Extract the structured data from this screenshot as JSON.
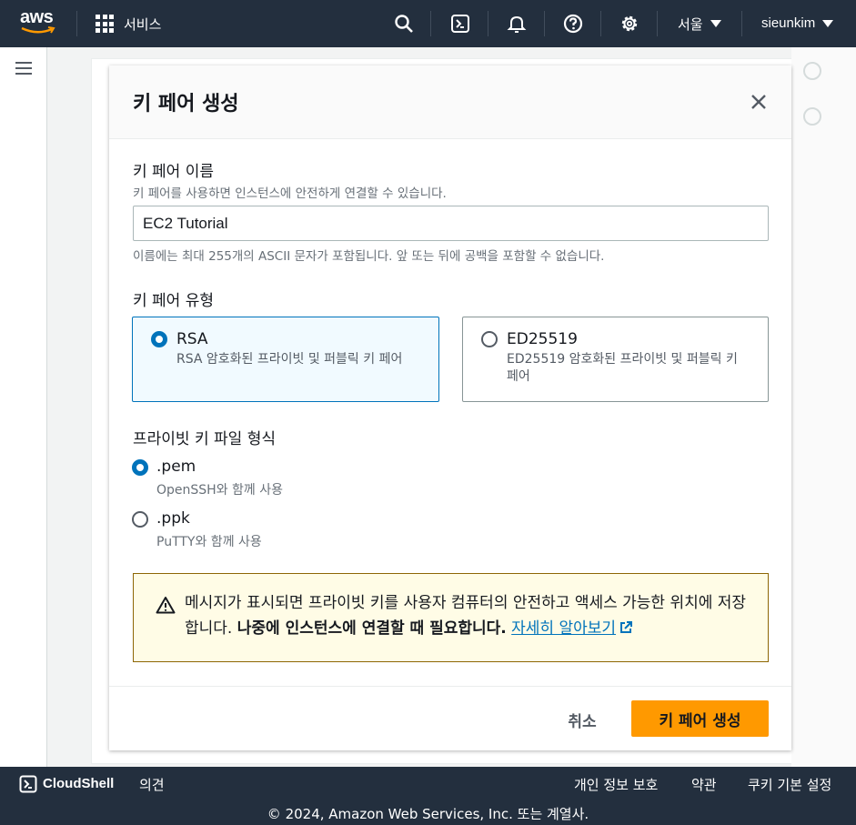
{
  "nav": {
    "logo_text": "aws",
    "services": "서비스",
    "region": "서울",
    "user": "sieunkim"
  },
  "modal": {
    "title": "키 페어 생성",
    "name_label": "키 페어 이름",
    "name_desc": "키 페어를 사용하면 인스턴스에 안전하게 연결할 수 있습니다.",
    "name_value": "EC2 Tutorial",
    "name_hint": "이름에는 최대 255개의 ASCII 문자가 포함됩니다. 앞 또는 뒤에 공백을 포함할 수 없습니다.",
    "type_label": "키 페어 유형",
    "types": [
      {
        "title": "RSA",
        "desc": "RSA 암호화된 프라이빗 및 퍼블릭 키 페어",
        "selected": true
      },
      {
        "title": "ED25519",
        "desc": "ED25519 암호화된 프라이빗 및 퍼블릭 키 페어",
        "selected": false
      }
    ],
    "format_label": "프라이빗 키 파일 형식",
    "formats": [
      {
        "title": ".pem",
        "desc": "OpenSSH와 함께 사용",
        "selected": true
      },
      {
        "title": ".ppk",
        "desc": "PuTTY와 함께 사용",
        "selected": false
      }
    ],
    "alert": {
      "text": "메시지가 표시되면 프라이빗 키를 사용자 컴퓨터의 안전하고 액세스 가능한 위치에 저장합니다. ",
      "bold": "나중에 인스턴스에 연결할 때 필요합니다.",
      "link": "자세히 알아보기"
    },
    "cancel": "취소",
    "create": "키 페어 생성"
  },
  "footer": {
    "cloudshell": "CloudShell",
    "feedback": "의견",
    "privacy": "개인 정보 보호",
    "terms": "약관",
    "cookies": "쿠키 기본 설정",
    "copyright": "© 2024, Amazon Web Services, Inc. 또는 계열사."
  },
  "colors": {
    "nav_bg": "#232f3e",
    "primary": "#ff9900",
    "link": "#0073bb",
    "alert_bg": "#fffce6"
  }
}
